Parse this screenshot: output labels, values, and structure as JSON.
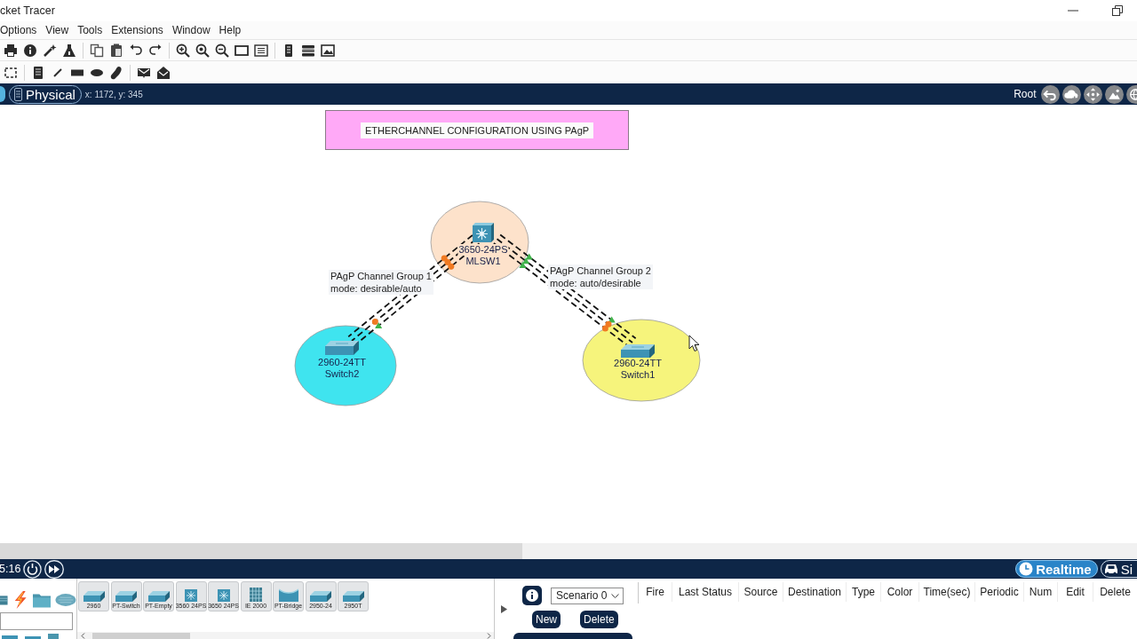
{
  "window": {
    "title": "cket Tracer"
  },
  "menu": [
    "Options",
    "View",
    "Tools",
    "Extensions",
    "Window",
    "Help"
  ],
  "workspace_bar": {
    "tabs": [
      {
        "label": "Physical",
        "selected": true
      }
    ],
    "coordinates": "x: 1172, y: 345",
    "root_label": "Root"
  },
  "canvas": {
    "title": "ETHERCHANNEL CONFIGURATION USING PAgP",
    "nodes": [
      {
        "kind": "multilayer_switch",
        "model": "3650-24PS",
        "name": "MLSW1",
        "color": "#fde2cb"
      },
      {
        "kind": "switch",
        "model": "2960-24TT",
        "name": "Switch2",
        "color": "#3fe4ef"
      },
      {
        "kind": "switch",
        "model": "2960-24TT",
        "name": "Switch1",
        "color": "#f6f47c"
      }
    ],
    "links": [
      {
        "kind": "etherchannel",
        "start_lights": [
          {
            "kind": "learning",
            "color": "#f07a22"
          },
          {
            "kind": "learning",
            "color": "#f07a22"
          },
          {
            "kind": "learning",
            "color": "#f07a22"
          }
        ],
        "end_lights": [
          {
            "kind": "up",
            "color": "#3fb24a"
          },
          {
            "kind": "learning",
            "color": "#f07a22"
          }
        ]
      },
      {
        "kind": "etherchannel",
        "start_lights": [
          {
            "kind": "up",
            "color": "#3fb24a"
          },
          {
            "kind": "up",
            "color": "#3fb24a"
          },
          {
            "kind": "up",
            "color": "#3fb24a"
          }
        ],
        "end_lights": [
          {
            "kind": "up",
            "color": "#3fb24a"
          },
          {
            "kind": "learning",
            "color": "#f07a22"
          },
          {
            "kind": "learning",
            "color": "#f07a22"
          }
        ]
      }
    ],
    "notes": [
      {
        "text": "PAgP Channel Group 1\nmode: desirable/auto"
      },
      {
        "text": "PAgP Channel Group 2\nmode: auto/desirable"
      }
    ]
  },
  "time_bar": {
    "clock": "5:16",
    "modes": [
      {
        "label": "Realtime",
        "selected": true
      },
      {
        "label": "Si",
        "selected": false
      }
    ]
  },
  "device_panel": {
    "devices": [
      {
        "label": "2960",
        "kind": "switch"
      },
      {
        "label": "PT-Switch",
        "kind": "switch"
      },
      {
        "label": "PT-Empty",
        "kind": "switch"
      },
      {
        "label": "3560 24PS",
        "kind": "multilayer"
      },
      {
        "label": "3650 24PS",
        "kind": "multilayer"
      },
      {
        "label": "IE 2000",
        "kind": "industrial"
      },
      {
        "label": "PT-Bridge",
        "kind": "bridge"
      },
      {
        "label": "2950-24",
        "kind": "switch"
      },
      {
        "label": "2950T",
        "kind": "switch"
      }
    ]
  },
  "scenario_panel": {
    "scenario": "Scenario 0",
    "buttons": [
      "New",
      "Delete"
    ]
  },
  "pdu_table": {
    "columns": [
      "Fire",
      "Last Status",
      "Source",
      "Destination",
      "Type",
      "Color",
      "Time(sec)",
      "Periodic",
      "Num",
      "Edit",
      "Delete"
    ]
  }
}
